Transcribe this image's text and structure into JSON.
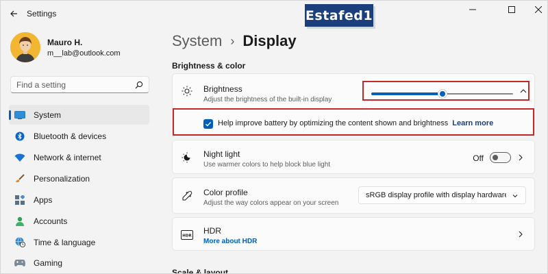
{
  "window": {
    "title": "Settings",
    "brand": "Estafed1"
  },
  "profile": {
    "name": "Mauro H.",
    "email": "m__lab@outlook.com"
  },
  "search": {
    "placeholder": "Find a setting"
  },
  "sidebar": {
    "items": [
      {
        "label": "System",
        "icon": "system-icon",
        "active": true
      },
      {
        "label": "Bluetooth & devices",
        "icon": "bluetooth-icon"
      },
      {
        "label": "Network & internet",
        "icon": "wifi-icon"
      },
      {
        "label": "Personalization",
        "icon": "brush-icon"
      },
      {
        "label": "Apps",
        "icon": "apps-icon"
      },
      {
        "label": "Accounts",
        "icon": "account-icon"
      },
      {
        "label": "Time & language",
        "icon": "globe-clock-icon"
      },
      {
        "label": "Gaming",
        "icon": "gamepad-icon"
      }
    ]
  },
  "breadcrumb": {
    "parent": "System",
    "current": "Display"
  },
  "sections": {
    "brightness_color": "Brightness & color",
    "scale_layout": "Scale & layout"
  },
  "brightness": {
    "title": "Brightness",
    "subtitle": "Adjust the brightness of the built-in display",
    "value_percent": 50,
    "checkbox_label": "Help improve battery by optimizing the content shown and brightness",
    "checkbox_checked": true,
    "learn_more": "Learn more"
  },
  "night_light": {
    "title": "Night light",
    "subtitle": "Use warmer colors to help block blue light",
    "state": "Off"
  },
  "color_profile": {
    "title": "Color profile",
    "subtitle": "Adjust the way colors appear on your screen",
    "selected": "sRGB display profile with display hardware configuration"
  },
  "hdr": {
    "title": "HDR",
    "link": "More about HDR"
  },
  "colors": {
    "accent": "#005fb8",
    "highlight_box": "#c0292a",
    "brand_bg": "#1b3f7a"
  }
}
